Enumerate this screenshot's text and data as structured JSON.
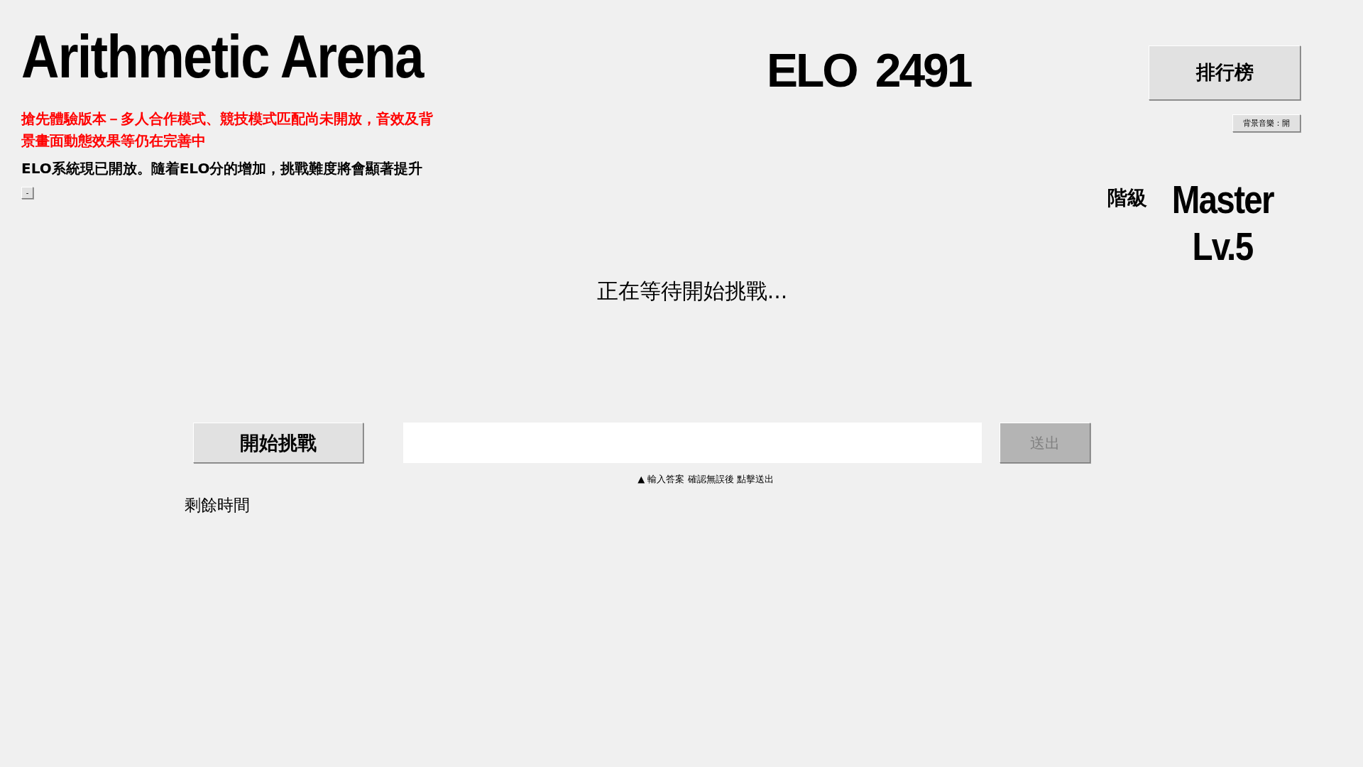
{
  "title": "Arithmetic Arena",
  "notices": [
    {
      "kind": "warning",
      "text": "搶先體驗版本－多人合作模式、競技模式匹配尚未開放，音效及背景畫面動態效果等仍在完善中"
    },
    {
      "kind": "info",
      "text": "ELO系統現已開放。隨着ELO分的增加，挑戰難度將會顯著提升"
    }
  ],
  "collapse_button": {
    "label": "-"
  },
  "elo": {
    "label": "ELO",
    "value": "2491"
  },
  "leaderboard_button": {
    "label": "排行榜"
  },
  "music_button": {
    "label": "背景音樂：開"
  },
  "rank": {
    "label": "階級",
    "tier": "Master",
    "grade": "Lv.5"
  },
  "status": "正在等待開始挑戰...",
  "start_button": {
    "label": "開始挑戰"
  },
  "submit_button": {
    "label": "送出",
    "disabled": true
  },
  "hint": "▲ 輸入答案 確認無誤後 點擊送出",
  "timer": {
    "label": "剩餘時間"
  }
}
